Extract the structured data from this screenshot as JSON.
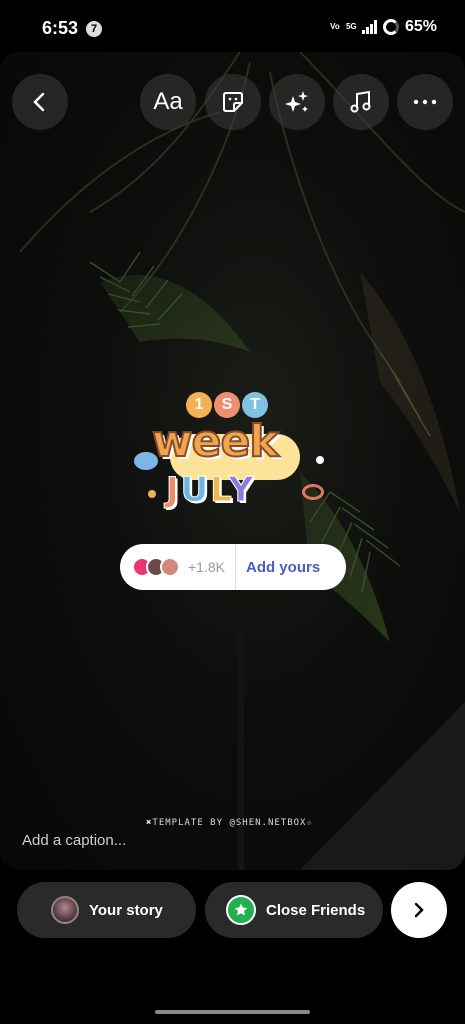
{
  "status_bar": {
    "time": "6:53",
    "notification_count": "7",
    "volte": "Vo",
    "network": "5G",
    "battery": "65%"
  },
  "toolbar": {
    "text_tool_label": "Aa",
    "icons": [
      "chevron-left-icon",
      "sticker-icon",
      "sparkles-icon",
      "music-note-icon",
      "more-icon"
    ]
  },
  "sticker": {
    "ordinal": [
      "1",
      "S",
      "T"
    ],
    "word1": "week",
    "word2_letters": [
      "J",
      "U",
      "L",
      "Y"
    ],
    "colors": {
      "ordinal": [
        "#f2b152",
        "#f08f70",
        "#7fc2e2"
      ],
      "july": [
        "#f08b6b",
        "#6db7e8",
        "#f4b54a",
        "#8f7be0"
      ]
    }
  },
  "add_yours": {
    "count": "+1.8K",
    "label": "Add yours"
  },
  "template_credit": "✖TEMPLATE BY @SHEN.NETBOX☆",
  "caption_placeholder": "Add a caption...",
  "share": {
    "your_story": "Your story",
    "close_friends": "Close Friends"
  },
  "colors": {
    "accent_link": "#4b5cc4",
    "close_friends_green": "#21b34b"
  }
}
